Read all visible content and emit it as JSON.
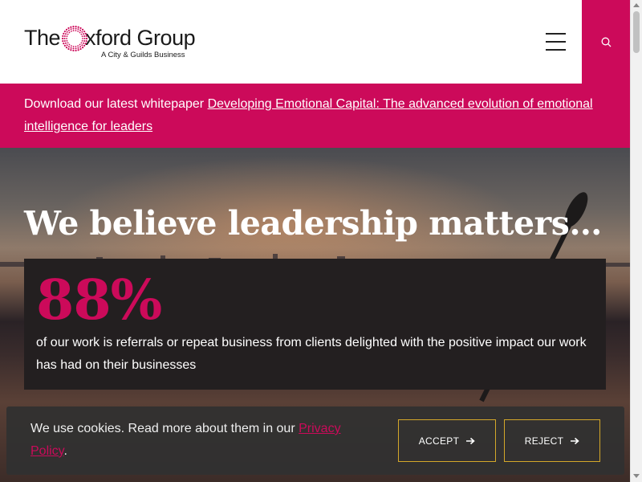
{
  "header": {
    "logo": {
      "name_pre": "The",
      "name_post": "xford Group",
      "tagline": "A City & Guilds Business"
    },
    "menu_icon": "hamburger-menu-icon",
    "search_icon": "search-icon"
  },
  "banner": {
    "prefix": "Download our latest whitepaper ",
    "link_text": "Developing Emotional Capital: The advanced evolution of emotional intelligence for leaders"
  },
  "hero": {
    "title": "We believe leadership matters…",
    "stat": {
      "number": "88%",
      "text": "of our work is referrals or repeat business from clients delighted with the positive impact our work has had on their businesses"
    }
  },
  "cookie_bar": {
    "text": "We use cookies. Read more about them in our ",
    "link_text": "Privacy Policy",
    "suffix": ".",
    "accept_label": "ACCEPT",
    "reject_label": "REJECT",
    "arrow_icon": "arrow-right-icon"
  },
  "colors": {
    "brand": "#cc0a5a",
    "stat_box": "#231f20",
    "cookie_border": "#d4a82a"
  }
}
